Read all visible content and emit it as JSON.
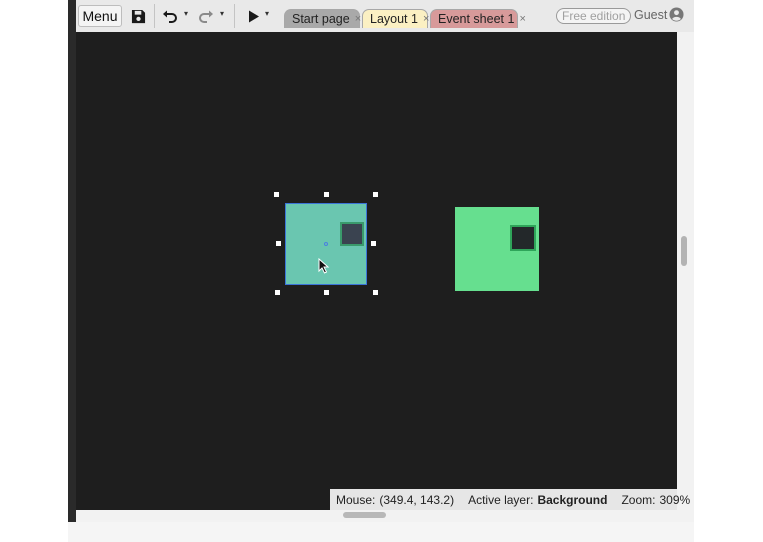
{
  "toolbar": {
    "menu_label": "Menu",
    "save_icon": "floppy-disk-icon",
    "undo_icon": "undo-icon",
    "redo_icon": "redo-icon",
    "play_icon": "play-icon",
    "dropdown_glyph": "▾"
  },
  "tabs": [
    {
      "label": "Start page",
      "close": "×",
      "active": false
    },
    {
      "label": "Layout 1",
      "close": "×",
      "active": true
    },
    {
      "label": "Event sheet 1",
      "close": "×",
      "active": false
    }
  ],
  "account": {
    "edition_badge": "Free edition",
    "user_label": "Guest",
    "user_icon": "user-circle-icon"
  },
  "status_bar": {
    "mouse_label": "Mouse:",
    "mouse_value": "(349.4, 143.2)",
    "layer_label": "Active layer:",
    "layer_value": "Background",
    "zoom_label": "Zoom:",
    "zoom_value": "309%"
  },
  "colors": {
    "canvas_bg": "#1e1e1e",
    "selected_sprite": "#6ac6b0",
    "selection_outline": "#3b74d8",
    "other_sprite": "#66df8f",
    "tab_layout": "#fbf0c3",
    "tab_event": "#d79a9a"
  }
}
